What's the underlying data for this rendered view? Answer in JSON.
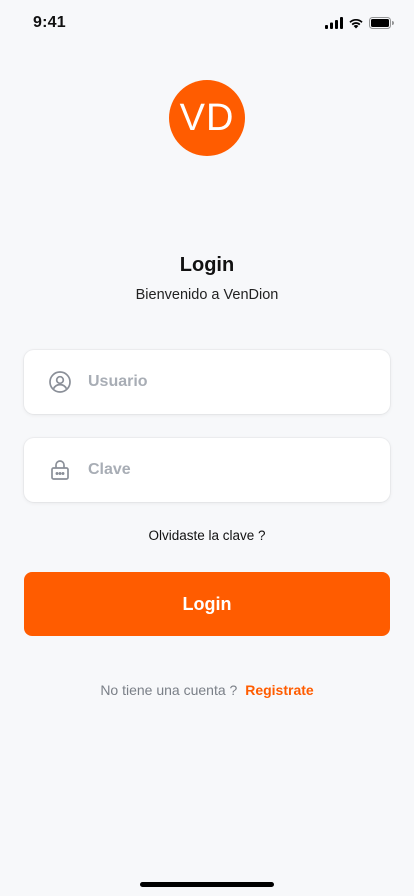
{
  "status_bar": {
    "time": "9:41",
    "icons": [
      "cellular-signal-icon",
      "wifi-icon",
      "battery-icon"
    ]
  },
  "logo": {
    "text": "VD",
    "color": "#FF5C00"
  },
  "title": "Login",
  "subtitle": "Bienvenido a VenDion",
  "form": {
    "username": {
      "placeholder": "Usuario",
      "value": "",
      "icon": "user-circle-icon"
    },
    "password": {
      "placeholder": "Clave",
      "value": "",
      "icon": "lock-icon"
    }
  },
  "forgot_password": "Olvidaste la clave ?",
  "login_button": "Login",
  "signup": {
    "prompt": "No tiene una cuenta ?",
    "link": "Registrate"
  },
  "colors": {
    "accent": "#FF5C00",
    "background": "#F7F8FA",
    "placeholder": "#A8ADB5"
  }
}
